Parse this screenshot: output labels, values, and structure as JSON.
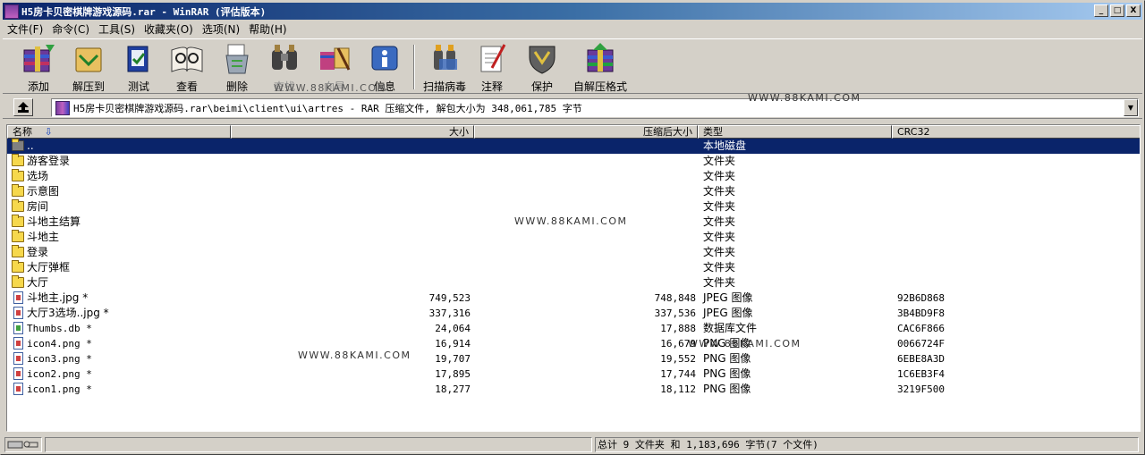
{
  "window": {
    "title": "H5房卡贝密棋牌游戏源码.rar - WinRAR (评估版本)",
    "minimize_glyph": "_",
    "maximize_glyph": "□",
    "close_glyph": "X"
  },
  "menu": [
    "文件(F)",
    "命令(C)",
    "工具(S)",
    "收藏夹(O)",
    "选项(N)",
    "帮助(H)"
  ],
  "toolbar": [
    {
      "label": "添加",
      "icon": "add-archive-icon"
    },
    {
      "label": "解压到",
      "icon": "extract-to-icon"
    },
    {
      "label": "测试",
      "icon": "test-icon"
    },
    {
      "label": "查看",
      "icon": "view-icon"
    },
    {
      "label": "删除",
      "icon": "delete-icon"
    },
    {
      "label": "查找",
      "icon": "find-icon"
    },
    {
      "label": "向导",
      "icon": "wizard-icon"
    },
    {
      "label": "信息",
      "icon": "info-icon"
    },
    {
      "label": "扫描病毒",
      "icon": "scan-virus-icon"
    },
    {
      "label": "注释",
      "icon": "comment-icon"
    },
    {
      "label": "保护",
      "icon": "protect-icon"
    },
    {
      "label": "自解压格式",
      "icon": "sfx-icon"
    }
  ],
  "address": {
    "path": "H5房卡贝密棋牌游戏源码.rar\\beimi\\client\\ui\\artres - RAR 压缩文件, 解包大小为 348,061,785 字节",
    "dropdown_glyph": "▼"
  },
  "columns": {
    "name": "名称",
    "size": "大小",
    "packed": "压缩后大小",
    "type": "类型",
    "crc": "CRC32",
    "sort_glyph": "⇩"
  },
  "rows": [
    {
      "name": "..",
      "size": "",
      "packed": "",
      "type": "本地磁盘",
      "crc": "",
      "kind": "parent"
    },
    {
      "name": "游客登录",
      "size": "",
      "packed": "",
      "type": "文件夹",
      "crc": "",
      "kind": "folder"
    },
    {
      "name": "选场",
      "size": "",
      "packed": "",
      "type": "文件夹",
      "crc": "",
      "kind": "folder"
    },
    {
      "name": "示意图",
      "size": "",
      "packed": "",
      "type": "文件夹",
      "crc": "",
      "kind": "folder"
    },
    {
      "name": "房间",
      "size": "",
      "packed": "",
      "type": "文件夹",
      "crc": "",
      "kind": "folder"
    },
    {
      "name": "斗地主结算",
      "size": "",
      "packed": "",
      "type": "文件夹",
      "crc": "",
      "kind": "folder"
    },
    {
      "name": "斗地主",
      "size": "",
      "packed": "",
      "type": "文件夹",
      "crc": "",
      "kind": "folder"
    },
    {
      "name": "登录",
      "size": "",
      "packed": "",
      "type": "文件夹",
      "crc": "",
      "kind": "folder"
    },
    {
      "name": "大厅弹框",
      "size": "",
      "packed": "",
      "type": "文件夹",
      "crc": "",
      "kind": "folder"
    },
    {
      "name": "大厅",
      "size": "",
      "packed": "",
      "type": "文件夹",
      "crc": "",
      "kind": "folder"
    },
    {
      "name": "斗地主.jpg *",
      "size": "749,523",
      "packed": "748,848",
      "type": "JPEG 图像",
      "crc": "92B6D868",
      "kind": "file"
    },
    {
      "name": "大厅3选场..jpg *",
      "size": "337,316",
      "packed": "337,536",
      "type": "JPEG 图像",
      "crc": "3B4BD9F8",
      "kind": "file"
    },
    {
      "name": "Thumbs.db *",
      "size": "24,064",
      "packed": "17,888",
      "type": "数据库文件",
      "crc": "CAC6F866",
      "kind": "db"
    },
    {
      "name": "icon4.png *",
      "size": "16,914",
      "packed": "16,679",
      "type": "PNG 图像",
      "crc": "0066724F",
      "kind": "file"
    },
    {
      "name": "icon3.png *",
      "size": "19,707",
      "packed": "19,552",
      "type": "PNG 图像",
      "crc": "6EBE8A3D",
      "kind": "file"
    },
    {
      "name": "icon2.png *",
      "size": "17,895",
      "packed": "17,744",
      "type": "PNG 图像",
      "crc": "1C6EB3F4",
      "kind": "file"
    },
    {
      "name": "icon1.png *",
      "size": "18,277",
      "packed": "18,112",
      "type": "PNG 图像",
      "crc": "3219F500",
      "kind": "file"
    }
  ],
  "watermark": "WWW.88KAMI.COM",
  "status": {
    "summary": "总计 9 文件夹 和 1,183,696 字节(7 个文件)"
  }
}
